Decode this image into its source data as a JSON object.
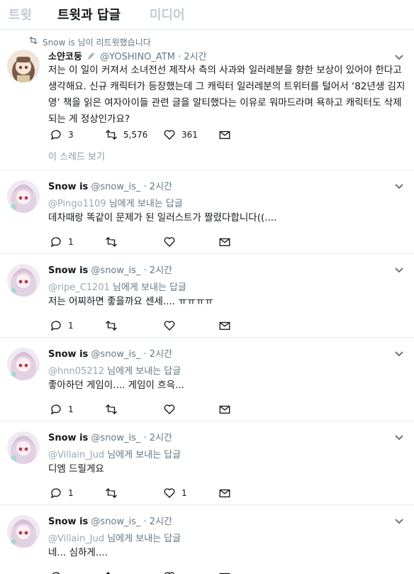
{
  "tabs": [
    "트윗",
    "트윗과 답글",
    "미디어"
  ],
  "retweet_notice": "Snow is 님이 리트윗했습니다",
  "main_tweet": {
    "name": "소얀코둥",
    "handle": "@YOSHINO_ATM",
    "time": "· 2시간",
    "text": "저는 이 일이 커져서 소녀전선 제작사 측의 사과와 일러레분을 향한 보상이 있어야 한다고 생각해요. 신규 캐릭터가 등장했는데 그 캐릭터 일러레분의 트위터를 털어서 ‘82년생 김지영’ 책을 읽은 여자아이들 관련 글을 알티했다는 이유로 워마드라며 욕하고 캐릭터도 삭제되는 게 정상인가요?",
    "replies": "3",
    "retweets": "5,576",
    "likes": "361",
    "thread_link": "이 스레드 보기"
  },
  "reply_label": "님에게 보내는 답글",
  "replies": [
    {
      "name": "Snow is",
      "handle": "@snow_is_",
      "time": "· 2시간",
      "to": "@Pingo1109",
      "text": "데차때랑 똑같이 문제가 된 일러스트가 짤렸다합니다((....",
      "replies": "1",
      "retweets": "",
      "likes": ""
    },
    {
      "name": "Snow is",
      "handle": "@snow_is_",
      "time": "· 2시간",
      "to": "@ripe_C1201",
      "text": "저는 어찌하면 좋을까요 센세.... ㅠㅠㅠㅠ",
      "replies": "1",
      "retweets": "",
      "likes": ""
    },
    {
      "name": "Snow is",
      "handle": "@snow_is_",
      "time": "· 2시간",
      "to": "@hnn05212",
      "text": "좋아하던 게임이.... 게임이 흐윽...",
      "replies": "1",
      "retweets": "",
      "likes": ""
    },
    {
      "name": "Snow is",
      "handle": "@snow_is_",
      "time": "· 2시간",
      "to": "@Villain_Jud",
      "text": "디엠 드릴게요",
      "replies": "1",
      "retweets": "",
      "likes": "1"
    },
    {
      "name": "Snow is",
      "handle": "@snow_is_",
      "time": "· 2시간",
      "to": "@Villain_Jud",
      "text": "네... 심하게....",
      "replies": "",
      "retweets": "",
      "likes": ""
    }
  ],
  "colors": {
    "text": "#14171a",
    "muted": "#657786",
    "border": "#e6ecf0",
    "tab_inactive": "#c3cbd2",
    "thread_link": "#8899a6"
  }
}
